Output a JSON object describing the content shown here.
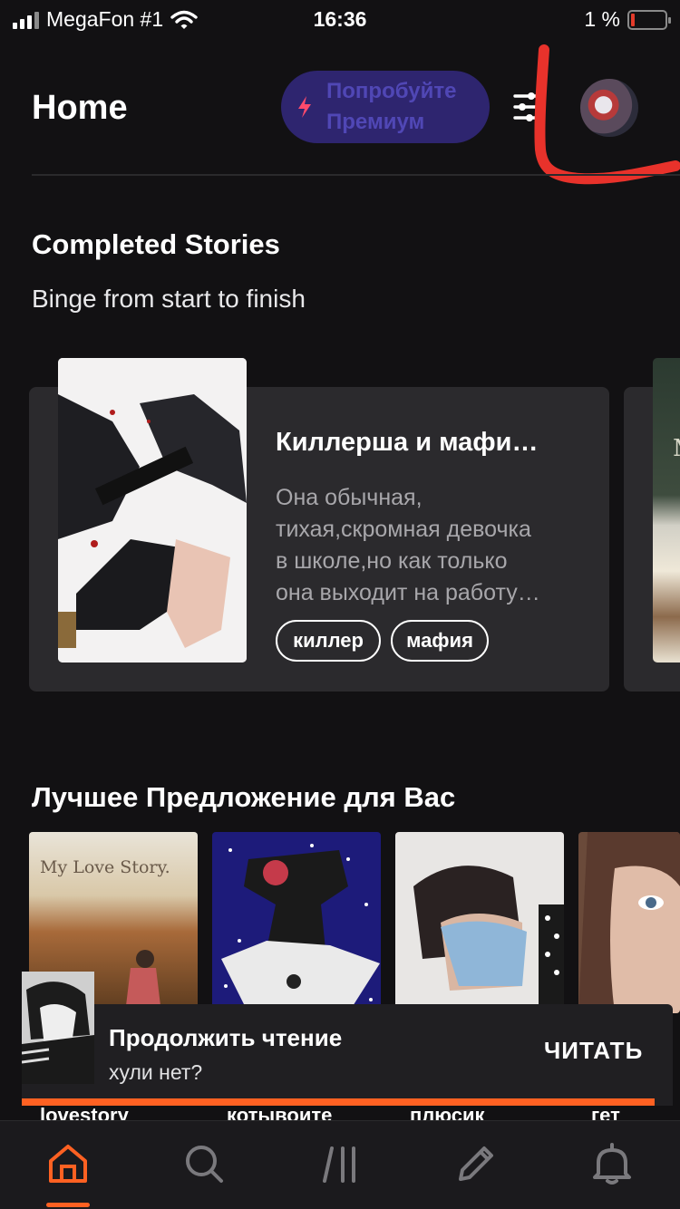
{
  "status": {
    "carrier": "MegaFon #1",
    "time": "16:36",
    "battery": "1 %",
    "battery_level": 0.01
  },
  "header": {
    "title": "Home",
    "premium_label": "Попробуйте Премиум",
    "icons": [
      "lightning-icon",
      "filter-icon",
      "avatar"
    ]
  },
  "completed": {
    "title": "Completed Stories",
    "subtitle": "Binge from start to finish",
    "story": {
      "title": "Киллерша и мафи…",
      "description": [
        "Она обычная,",
        "тихая,скромная девочка",
        "в школе,но как только",
        "она выходит на работу…"
      ],
      "tags": [
        "киллер",
        "мафия"
      ]
    },
    "next_cover_text": "M"
  },
  "recommended": {
    "title": "Лучшее Предложение для Вас",
    "thumbs": [
      {
        "cover_text": "My Love Story.",
        "label": "lovestory"
      },
      {
        "cover_text": "",
        "label": "котывоите"
      },
      {
        "cover_text": "",
        "label": "плюсик"
      },
      {
        "cover_text": "",
        "label": "гет"
      }
    ]
  },
  "continue_reading": {
    "title": "Продолжить чтение",
    "subtitle": "хули нет?",
    "action": "ЧИТАТЬ",
    "progress": 1.0
  },
  "tabs": [
    {
      "icon": "home-icon",
      "active": true
    },
    {
      "icon": "search-icon",
      "active": false
    },
    {
      "icon": "library-icon",
      "active": false
    },
    {
      "icon": "write-icon",
      "active": false
    },
    {
      "icon": "bell-icon",
      "active": false
    }
  ],
  "colors": {
    "accent": "#ff6122",
    "background": "#121113",
    "card": "#2b2a2d",
    "premium_bg": "#2e256f",
    "annotation": "#e8322b"
  }
}
